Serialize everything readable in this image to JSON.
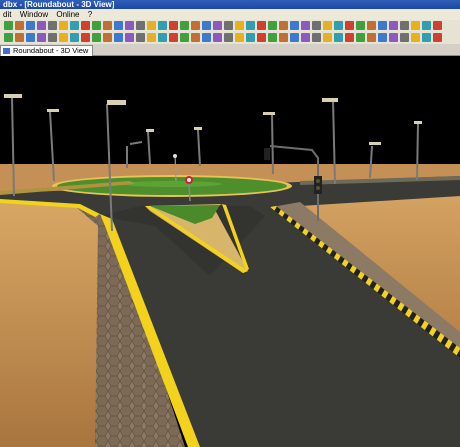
{
  "window": {
    "title": "dbx - [Roundabout - 3D View]"
  },
  "menu": {
    "items": [
      "dit",
      "Window",
      "Online",
      "?"
    ]
  },
  "tab": {
    "label": "Roundabout - 3D View"
  },
  "colors": {
    "sky": "#000000",
    "sand": "#c8935a",
    "road": "#393936",
    "curb": "#f2d21c",
    "grass": "#4e8f2c",
    "paving": "#8a7560"
  }
}
